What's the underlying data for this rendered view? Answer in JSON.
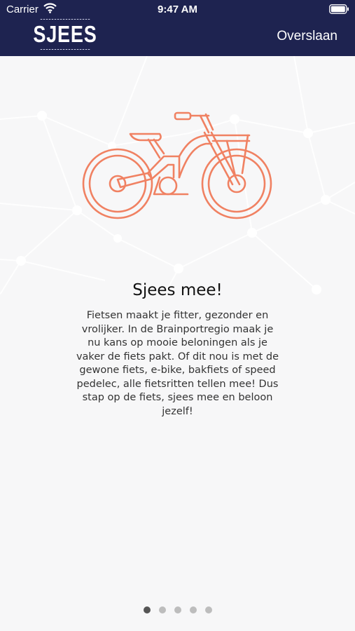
{
  "status_bar": {
    "carrier": "Carrier",
    "time": "9:47 AM",
    "wifi_icon": "wifi-icon",
    "battery_icon": "battery-icon"
  },
  "header": {
    "logo_text": "SJEES",
    "skip_label": "Overslaan",
    "background_color": "#1e2350"
  },
  "illustration": {
    "icon": "bicycle-icon",
    "color": "#f08162"
  },
  "content": {
    "title": "Sjees mee!",
    "lines": [
      "Fietsen maakt je fitter, gezonder en",
      "vrolijker. In de Brainportregio maak je",
      "nu kans op mooie beloningen als je",
      "vaker de fiets pakt. Of dit nou is met de",
      "gewone fiets, e-bike, bakfiets of speed",
      "pedelec, alle fietsritten tellen mee! Dus",
      "stap op de fiets, sjees mee en beloon",
      "jezelf!"
    ]
  },
  "pager": {
    "page_count": 5,
    "current_page": 1
  }
}
